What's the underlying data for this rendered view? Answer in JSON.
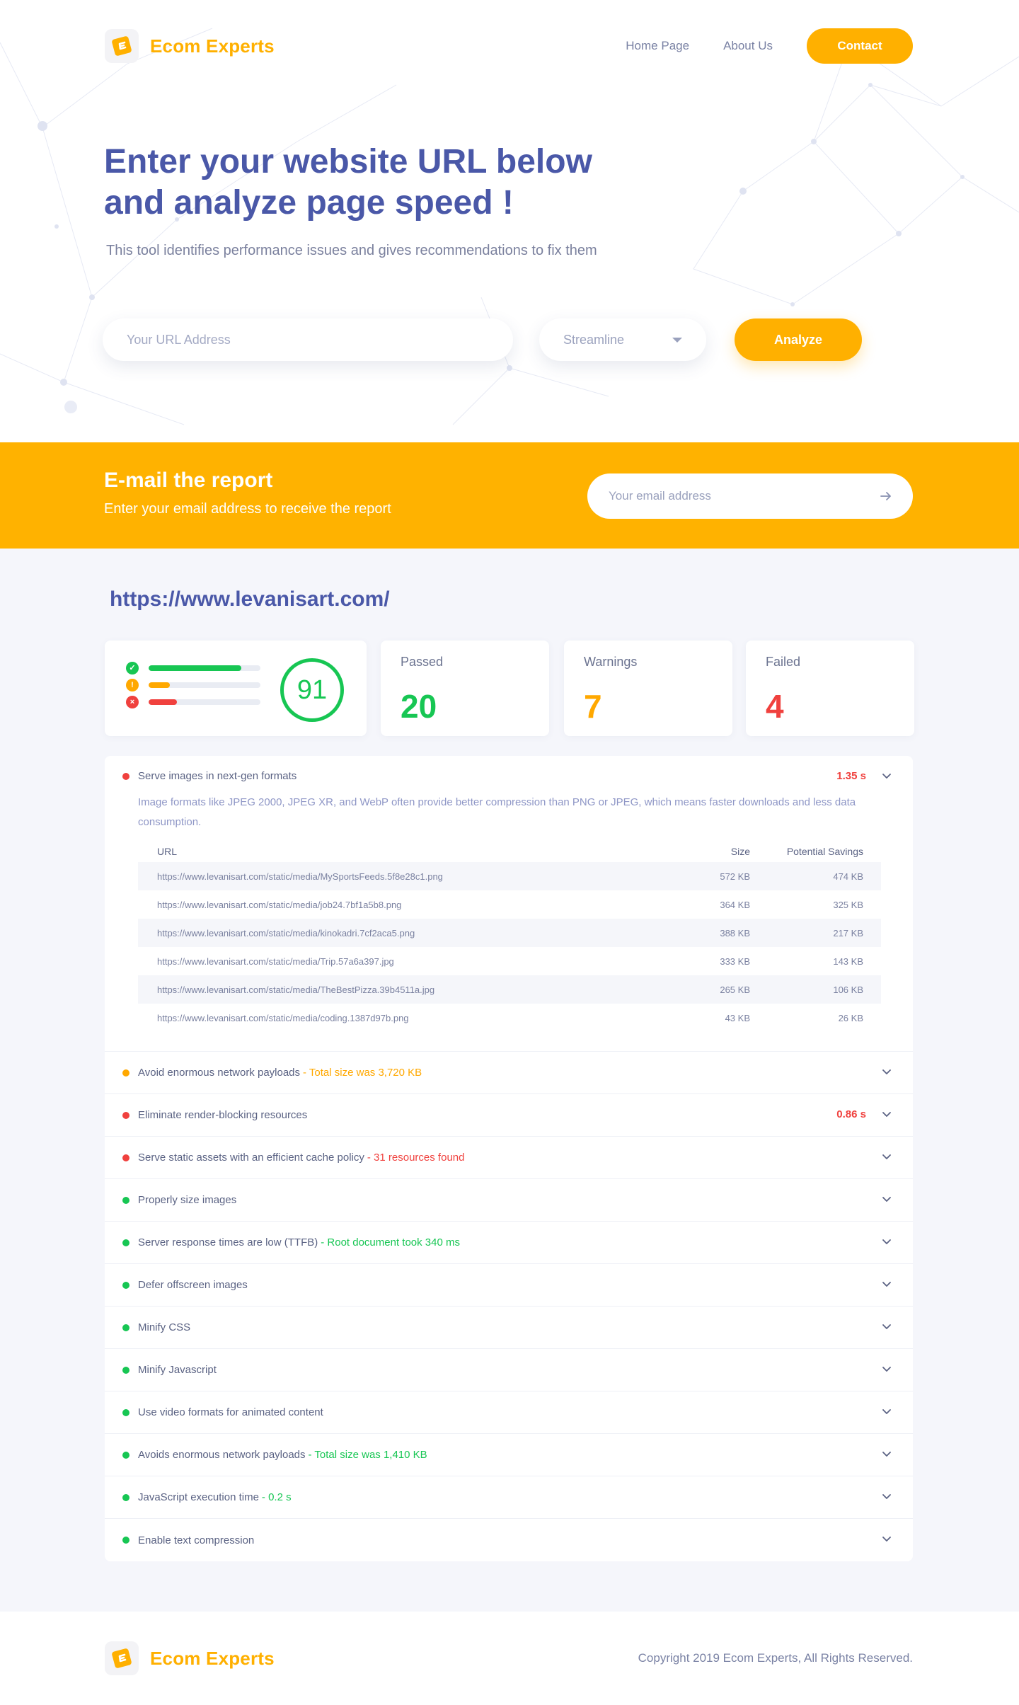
{
  "header": {
    "logo_text": "Ecom Experts",
    "nav": [
      {
        "label": "Home Page"
      },
      {
        "label": "About Us"
      }
    ],
    "contact_label": "Contact"
  },
  "hero": {
    "title_line1": "Enter your website URL below",
    "title_line2": "and analyze page speed !",
    "subtitle": "This tool identifies performance issues and gives recommendations to fix them",
    "url_placeholder": "Your URL Address",
    "mode_selected": "Streamline",
    "analyze_label": "Analyze"
  },
  "email": {
    "title": "E-mail the report",
    "subtitle": "Enter your email address to receive the report",
    "placeholder": "Your email address"
  },
  "report": {
    "site_url": "https://www.levanisart.com/",
    "score": "91",
    "bars": {
      "passed": 0.83,
      "warning": 0.19,
      "failed": 0.25
    },
    "stats": {
      "passed_label": "Passed",
      "passed_value": "20",
      "warnings_label": "Warnings",
      "warnings_value": "7",
      "failed_label": "Failed",
      "failed_value": "4"
    },
    "colors": {
      "pass": "#17c653",
      "warn": "#ffa800",
      "fail": "#f0413e",
      "accent": "#ffb000",
      "primary": "#4a58a8"
    },
    "first_audit": {
      "title": "Serve images in next-gen formats",
      "time": "1.35 s",
      "description": "Image formats like JPEG 2000, JPEG XR, and WebP often provide better compression than PNG or JPEG, which means faster downloads and less data consumption.",
      "columns": {
        "url": "URL",
        "size": "Size",
        "savings": "Potential Savings"
      },
      "rows": [
        {
          "url": "https://www.levanisart.com/static/media/MySportsFeeds.5f8e28c1.png",
          "size": "572 KB",
          "savings": "474 KB"
        },
        {
          "url": "https://www.levanisart.com/static/media/job24.7bf1a5b8.png",
          "size": "364 KB",
          "savings": "325 KB"
        },
        {
          "url": "https://www.levanisart.com/static/media/kinokadri.7cf2aca5.png",
          "size": "388 KB",
          "savings": "217 KB"
        },
        {
          "url": "https://www.levanisart.com/static/media/Trip.57a6a397.jpg",
          "size": "333 KB",
          "savings": "143 KB"
        },
        {
          "url": "https://www.levanisart.com/static/media/TheBestPizza.39b4511a.jpg",
          "size": "265 KB",
          "savings": "106 KB"
        },
        {
          "url": "https://www.levanisart.com/static/media/coding.1387d97b.png",
          "size": "43 KB",
          "savings": "26 KB"
        }
      ]
    },
    "audits": [
      {
        "status": "warn",
        "title": "Avoid enormous network payloads",
        "detail": "- Total size was 3,720 KB",
        "time": ""
      },
      {
        "status": "fail",
        "title": "Eliminate render-blocking resources",
        "detail": "",
        "time": "0.86 s"
      },
      {
        "status": "fail",
        "title": "Serve static assets with an efficient cache policy",
        "detail": "- 31 resources found",
        "time": ""
      },
      {
        "status": "pass",
        "title": "Properly size images",
        "detail": "",
        "time": ""
      },
      {
        "status": "pass",
        "title": "Server response times are low (TTFB)",
        "detail": "- Root document took 340 ms",
        "time": ""
      },
      {
        "status": "pass",
        "title": "Defer offscreen images",
        "detail": "",
        "time": ""
      },
      {
        "status": "pass",
        "title": "Minify CSS",
        "detail": "",
        "time": ""
      },
      {
        "status": "pass",
        "title": "Minify Javascript",
        "detail": "",
        "time": ""
      },
      {
        "status": "pass",
        "title": "Use video formats for animated content",
        "detail": "",
        "time": ""
      },
      {
        "status": "pass",
        "title": "Avoids enormous network payloads",
        "detail": "- Total size was 1,410 KB",
        "time": ""
      },
      {
        "status": "pass",
        "title": "JavaScript execution time",
        "detail": "- 0.2 s",
        "time": ""
      },
      {
        "status": "pass",
        "title": "Enable text compression",
        "detail": "",
        "time": ""
      }
    ]
  },
  "footer": {
    "logo_text": "Ecom Experts",
    "copyright": "Copyright 2019 Ecom Experts, All Rights Reserved."
  }
}
